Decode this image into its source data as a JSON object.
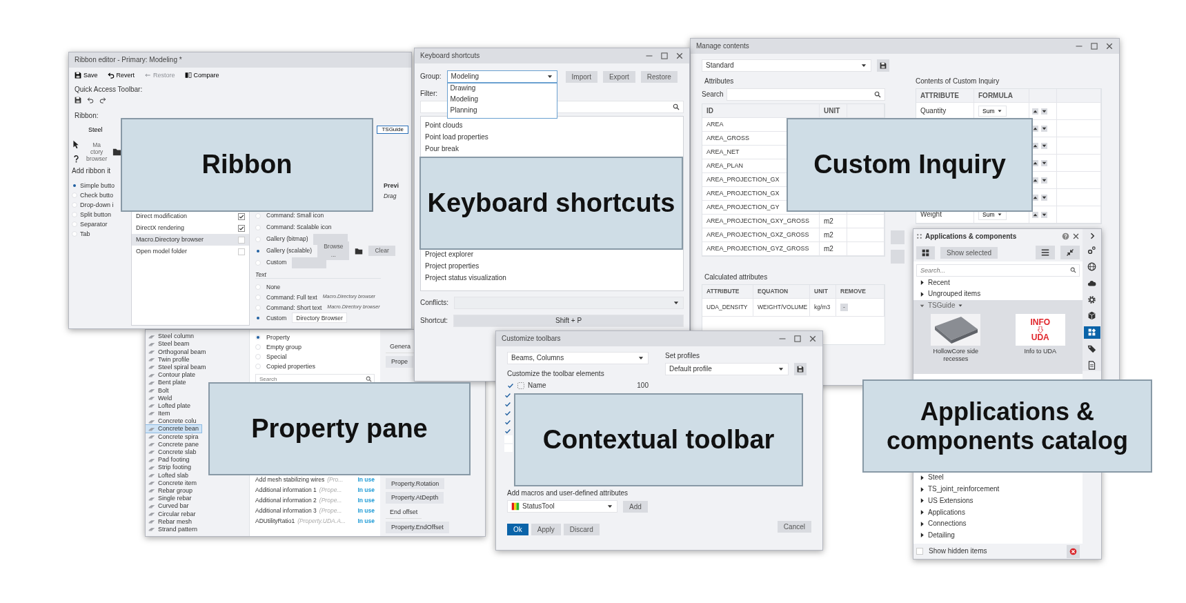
{
  "ribbon_editor": {
    "title": "Ribbon editor - Primary: Modeling *",
    "toolbar": [
      {
        "label": "Save",
        "kind": "save",
        "disabled": false
      },
      {
        "label": "Revert",
        "kind": "revert",
        "disabled": false
      },
      {
        "label": "Restore",
        "kind": "restore",
        "disabled": true
      },
      {
        "label": "Compare",
        "kind": "compare",
        "disabled": false
      }
    ],
    "quick_access_label": "Quick Access Toolbar:",
    "ribbon_label": "Ribbon:",
    "ribbon_tabs": [
      {
        "label": "Steel",
        "selected": false
      },
      {
        "label": "TSGuide",
        "selected": true
      }
    ],
    "ribbon_button_lines": [
      "Ma",
      "ctory",
      "browser"
    ],
    "add_items_label": "Add ribbon it",
    "item_types": [
      {
        "label": "Simple butto",
        "selected": true
      },
      {
        "label": "Check butto",
        "selected": false
      },
      {
        "label": "Drop-down i",
        "selected": false
      },
      {
        "label": "Split button",
        "selected": false
      },
      {
        "label": "Separator",
        "selected": false
      },
      {
        "label": "Tab",
        "selected": false
      }
    ],
    "commands": [
      {
        "label": "Direct modification",
        "checked": true,
        "selected": false
      },
      {
        "label": "DirectX rendering",
        "checked": true,
        "selected": false
      },
      {
        "label": "Macro.Directory browser",
        "checked": false,
        "selected": true
      },
      {
        "label": "Open model folder",
        "checked": false,
        "selected": false
      }
    ],
    "icon_options": [
      {
        "label": "Command: Small icon",
        "selected": false,
        "kind": "plain"
      },
      {
        "label": "Command: Scalable icon",
        "selected": false,
        "kind": "plain"
      },
      {
        "label": "Gallery (bitmap)",
        "selected": false,
        "kind": "disabled_button"
      },
      {
        "label": "Gallery (scalable)",
        "selected": true,
        "kind": "browse",
        "browse": "Browse ...",
        "clear": "Clear"
      },
      {
        "label": "Custom",
        "selected": false,
        "kind": "disabled_button"
      }
    ],
    "text_heading": "Text",
    "text_options": [
      {
        "label": "None",
        "selected": false
      },
      {
        "label": "Command: Full text",
        "selected": false,
        "hint": "Macro.Directory browser"
      },
      {
        "label": "Command: Short text",
        "selected": false,
        "hint": "Macro.Directory browser"
      },
      {
        "label": "Custom",
        "selected": true,
        "value": "Directory Browser"
      }
    ],
    "preview_label": "Previ",
    "preview_hint": "Drag"
  },
  "keyboard_shortcuts": {
    "title": "Keyboard shortcuts",
    "group_label": "Group:",
    "group_value": "Modeling",
    "group_options": [
      "Drawing",
      "Modeling",
      "Planning"
    ],
    "buttons": [
      "Import",
      "Export",
      "Restore"
    ],
    "filter_label": "Filter:",
    "items_top": [
      "Point clouds",
      "Point load properties",
      "Pour break"
    ],
    "items_bottom": [
      "Project explorer",
      "Project properties",
      "Project status visualization"
    ],
    "conflicts_label": "Conflicts:",
    "shortcut_label": "Shortcut:",
    "shortcut_value": "Shift + P"
  },
  "manage_contents": {
    "title": "Manage contents",
    "preset": "Standard",
    "attributes_label": "Attributes",
    "search_label": "Search",
    "attr_columns": [
      "ID",
      "UNIT"
    ],
    "attr_rows": [
      {
        "id": "AREA"
      },
      {
        "id": "AREA_GROSS"
      },
      {
        "id": "AREA_NET"
      },
      {
        "id": "AREA_PLAN"
      },
      {
        "id": "AREA_PROJECTION_GX"
      },
      {
        "id": "AREA_PROJECTION_GX"
      },
      {
        "id": "AREA_PROJECTION_GY"
      },
      {
        "id": "AREA_PROJECTION_GXY_GROSS",
        "unit": "m2"
      },
      {
        "id": "AREA_PROJECTION_GXZ_GROSS",
        "unit": "m2"
      },
      {
        "id": "AREA_PROJECTION_GYZ_GROSS",
        "unit": "m2"
      }
    ],
    "calc_label": "Calculated attributes",
    "calc_columns": [
      "ATTRIBUTE",
      "EQUATION",
      "UNIT",
      "REMOVE"
    ],
    "calc_rows": [
      {
        "attribute": "UDA_DENSITY",
        "equation": "WEIGHT/VOLUME",
        "unit": "kg/m3",
        "remove": "-"
      }
    ],
    "inquiry_label": "Contents of Custom Inquiry",
    "inquiry_columns": [
      "ATTRIBUTE",
      "FORMULA"
    ],
    "inquiry_rows": [
      {
        "attribute": "Quantity",
        "formula": "Sum"
      },
      {
        "attribute": "Weight",
        "formula": "Sum"
      }
    ]
  },
  "property_pane": {
    "components": [
      {
        "label": "Steel column",
        "selected": false
      },
      {
        "label": "Steel beam",
        "selected": false
      },
      {
        "label": "Orthogonal beam",
        "selected": false
      },
      {
        "label": "Twin profile",
        "selected": false
      },
      {
        "label": "Steel spiral beam",
        "selected": false
      },
      {
        "label": "Contour plate",
        "selected": false
      },
      {
        "label": "Bent plate",
        "selected": false
      },
      {
        "label": "Bolt",
        "selected": false
      },
      {
        "label": "Weld",
        "selected": false
      },
      {
        "label": "Lofted plate",
        "selected": false
      },
      {
        "label": "Item",
        "selected": false
      },
      {
        "label": "Concrete colu",
        "selected": false
      },
      {
        "label": "Concrete bean",
        "selected": true
      },
      {
        "label": "Concrete spira",
        "selected": false
      },
      {
        "label": "Concrete pane",
        "selected": false
      },
      {
        "label": "Concrete slab",
        "selected": false
      },
      {
        "label": "Pad footing",
        "selected": false
      },
      {
        "label": "Strip footing",
        "selected": false
      },
      {
        "label": "Lofted slab",
        "selected": false
      },
      {
        "label": "Concrete item",
        "selected": false
      },
      {
        "label": "Rebar group",
        "selected": false
      },
      {
        "label": "Single rebar",
        "selected": false
      },
      {
        "label": "Curved bar",
        "selected": false
      },
      {
        "label": "Circular rebar",
        "selected": false
      },
      {
        "label": "Rebar mesh",
        "selected": false
      },
      {
        "label": "Strand pattern",
        "selected": false
      }
    ],
    "property_types": [
      {
        "label": "Property",
        "selected": true
      },
      {
        "label": "Empty group",
        "selected": false
      },
      {
        "label": "Special",
        "selected": false
      },
      {
        "label": "Copied properties",
        "selected": false
      }
    ],
    "search_placeholder": "Search",
    "properties": [
      {
        "name": "Add mesh stabilizing wires",
        "detail": "(Pro...",
        "status": "In use"
      },
      {
        "name": "Additional information 1",
        "detail": "(Prope...",
        "status": "In use"
      },
      {
        "name": "Additional information 2",
        "detail": "(Prope...",
        "status": "In use"
      },
      {
        "name": "Additional information 3",
        "detail": "(Prope...",
        "status": "In use"
      },
      {
        "name": "ADUtilityRatio1",
        "detail": "(Property.UDA.A...",
        "status": "In use"
      }
    ],
    "groups_top": [
      {
        "kind": "header",
        "label": "Genera"
      },
      {
        "kind": "field",
        "label": "Prope"
      }
    ],
    "groups_bottom": [
      {
        "kind": "field",
        "label": "Property.Rotation"
      },
      {
        "kind": "field",
        "label": "Property.AtDepth"
      },
      {
        "kind": "header",
        "label": "End offset"
      },
      {
        "kind": "field",
        "label": "Property.EndOffset"
      }
    ]
  },
  "customize_toolbars": {
    "title": "Customize toolbars",
    "category": "Beams, Columns",
    "profiles_label": "Set profiles",
    "profile": "Default profile",
    "elements_label": "Customize the toolbar elements",
    "elements": [
      {
        "label": "Name",
        "value": "100",
        "checked": true
      }
    ],
    "hidden_elements": [
      {
        "checked": true
      },
      {
        "checked": true
      },
      {
        "checked": true
      },
      {
        "checked": true
      },
      {
        "checked": true
      },
      {
        "checked": false
      },
      {
        "checked": false
      }
    ],
    "macros_label": "Add macros and user-defined attributes",
    "macro": "StatusTool",
    "add": "Add",
    "actions": [
      {
        "label": "Ok",
        "kind": "primary"
      },
      {
        "label": "Apply",
        "kind": "secondary"
      },
      {
        "label": "Discard",
        "kind": "secondary"
      }
    ],
    "cancel": "Cancel"
  },
  "applications": {
    "title": "Applications & components",
    "show_selected": "Show selected",
    "search_placeholder": "Search...",
    "tree_top": [
      {
        "label": "Recent",
        "expanded": false
      },
      {
        "label": "Ungrouped items",
        "expanded": false
      },
      {
        "label": "TSGuide",
        "expanded": true
      }
    ],
    "tiles": [
      {
        "caption": "HollowCore side recesses",
        "kind": "photo"
      },
      {
        "caption": "Info to UDA",
        "kind": "info",
        "top": "INFO",
        "bottom": "UDA"
      }
    ],
    "tree_bottom": [
      {
        "label": "Steel",
        "expanded": false
      },
      {
        "label": "TS_joint_reinforcement",
        "expanded": false
      },
      {
        "label": "US Extensions",
        "expanded": false
      },
      {
        "label": "Applications",
        "expanded": false
      },
      {
        "label": "Connections",
        "expanded": false
      },
      {
        "label": "Detailing",
        "expanded": false
      }
    ],
    "show_hidden": {
      "label": "Show hidden items",
      "checked": false
    },
    "side_tools": [
      {
        "kind": "gears",
        "selected": false
      },
      {
        "kind": "globe",
        "selected": false
      },
      {
        "kind": "cloud",
        "selected": false
      },
      {
        "kind": "gear",
        "selected": false
      },
      {
        "kind": "cube",
        "selected": false
      },
      {
        "kind": "apps",
        "selected": true
      },
      {
        "kind": "tag",
        "selected": false
      },
      {
        "kind": "doc",
        "selected": false
      }
    ]
  },
  "callouts": [
    {
      "label": "Ribbon"
    },
    {
      "label": "Keyboard shortcuts"
    },
    {
      "label": "Custom Inquiry"
    },
    {
      "label": "Property pane"
    },
    {
      "label": "Contextual toolbar"
    },
    {
      "label": "Applications & components catalog"
    }
  ]
}
